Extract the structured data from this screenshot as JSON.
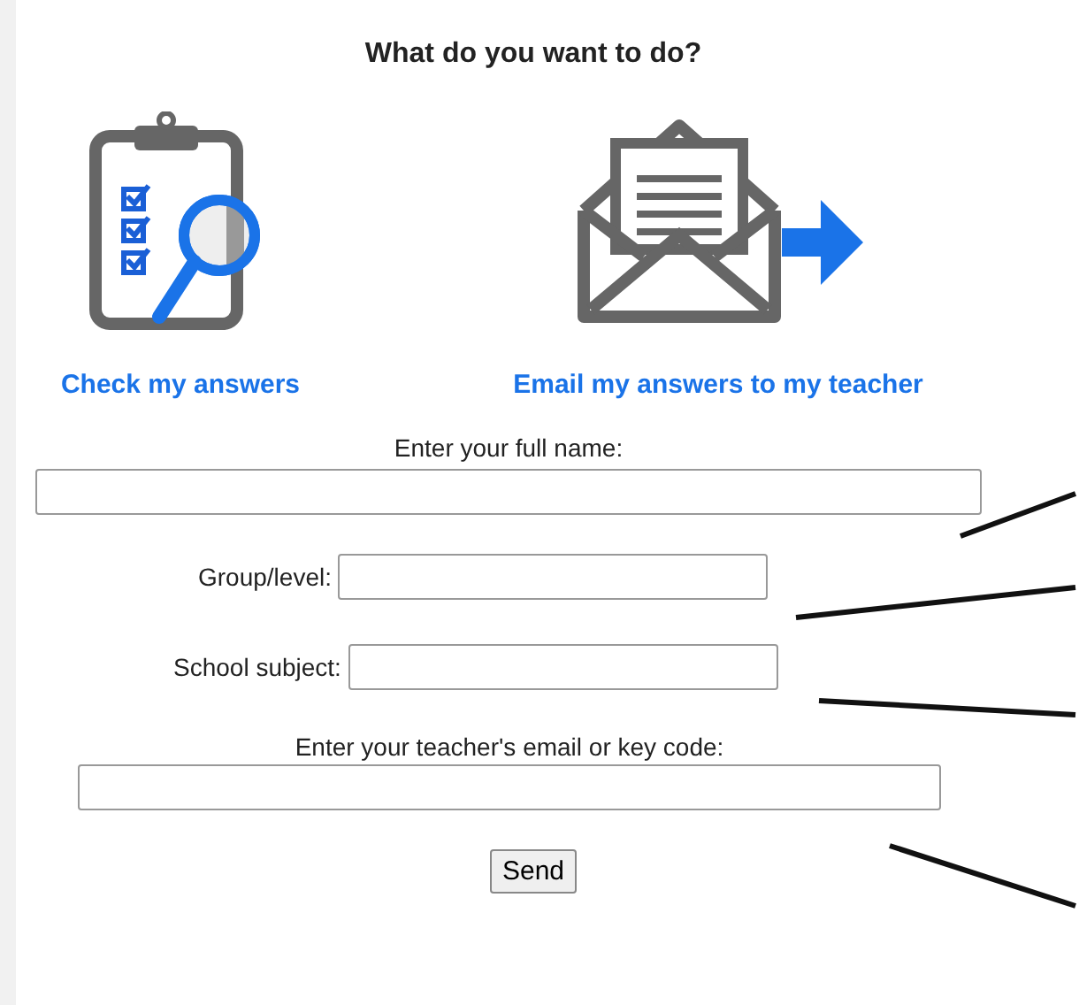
{
  "title": "What do you want to do?",
  "actions": [
    {
      "kind": "check",
      "label": "Check my answers"
    },
    {
      "kind": "email",
      "label": "Email my answers to my teacher"
    }
  ],
  "fields": [
    {
      "kind": "stacked",
      "label": "Enter your full name:"
    },
    {
      "kind": "inline",
      "label": "Group/level:"
    },
    {
      "kind": "inline",
      "label": "School subject:"
    },
    {
      "kind": "stacked",
      "label": "Enter your teacher's email or key code:"
    }
  ],
  "send_button": "Send"
}
